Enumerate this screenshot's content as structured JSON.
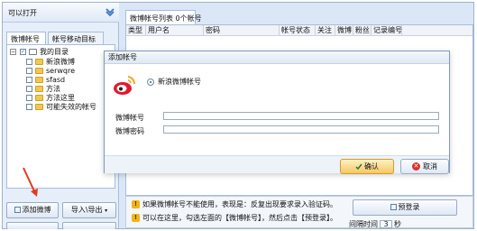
{
  "left_panel": {
    "header_title": "可以打开",
    "tabs": [
      "微博帐号",
      "帐号移动目标"
    ],
    "tree": {
      "root_label": "我的目录",
      "children": [
        "新浪微博",
        "serwqre",
        "sfasd",
        "方法",
        "方法这里",
        "可能失效的帐号"
      ]
    },
    "buttons": {
      "add_weibo": "添加微博",
      "import_export": "导入\\导出"
    }
  },
  "right_panel": {
    "tab_label": "微博帐号列表 0个帐号",
    "columns": [
      "类型",
      "用户名",
      "密码",
      "帐号状态",
      "关注",
      "微博",
      "粉丝",
      "记录编号"
    ],
    "info": {
      "line1": "如果微博帐号不能使用，表现是：反复出现要求录入验证码。",
      "line2": "可以在这里，勾选左面的【微博帐号】，然后点击【预登录】。",
      "login_button": "预登录",
      "interval_label": "间隔时间",
      "interval_value": "3",
      "interval_unit": "秒"
    }
  },
  "dialog": {
    "title": "添加帐号",
    "radio_label": "新浪微博帐号",
    "account_label": "微博帐号",
    "account_value": "",
    "password_label": "微博密码",
    "password_value": "",
    "ok_label": "确认",
    "cancel_label": "取消",
    "cancel_icon_glyph": "✕"
  },
  "colors": {
    "annotation_arrow": "#e23a1f",
    "weibo_red": "#e6162d",
    "weibo_orange": "#f5a623",
    "ok_button": "#f5c862"
  },
  "icons": [
    "collapse-icon",
    "checkbox-icon",
    "folder-icon",
    "warning-icon",
    "weibo-logo-icon",
    "confirm-icon",
    "cancel-icon",
    "login-icon",
    "add-icon",
    "dropdown-icon"
  ]
}
